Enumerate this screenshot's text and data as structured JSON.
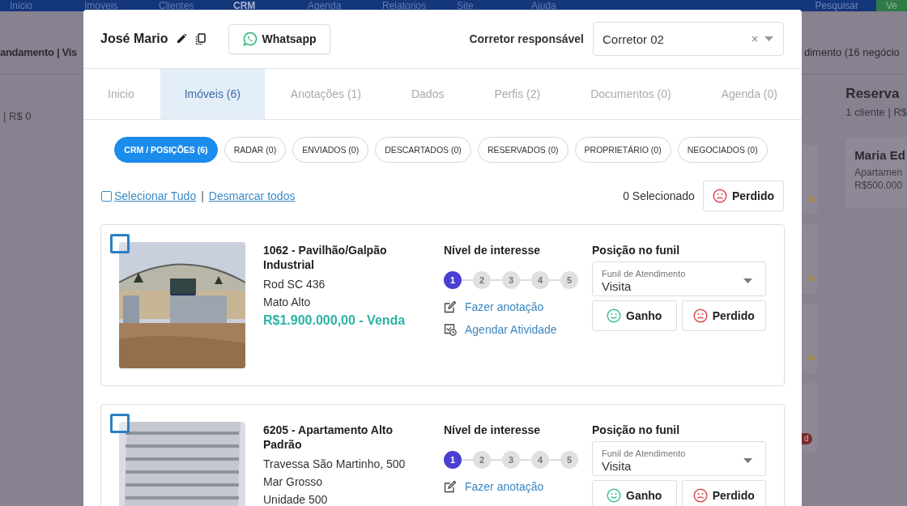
{
  "background_page": {
    "nav": [
      {
        "label": "Inicio",
        "selected": false
      },
      {
        "label": "Imoveis",
        "selected": false
      },
      {
        "label": "Clientes",
        "selected": false
      },
      {
        "label": "CRM",
        "selected": true
      },
      {
        "label": "Agenda",
        "selected": false
      },
      {
        "label": "Relatorios",
        "selected": false
      },
      {
        "label": "Site",
        "selected": false
      },
      {
        "label": "Ajuda",
        "selected": false
      }
    ],
    "search": "Pesquisar",
    "action_button": "Ve",
    "left_column": {
      "title": "andamento | Vis",
      "summary": "| R$ 0"
    },
    "right_column": {
      "title": "dimento (16 negócio",
      "stage": "Reserva",
      "summary": "1 cliente | R$",
      "card": {
        "name": "Maria Ed",
        "type": "Apartamen",
        "price": "R$500.000"
      },
      "badge": "d"
    }
  },
  "modal": {
    "contact_name": "José Mario",
    "whatsapp_button": "Whatsapp",
    "broker_label": "Corretor responsável",
    "broker_value": "Corretor 02",
    "tabs": [
      {
        "label": "Inicio",
        "selected": false
      },
      {
        "label": "Imóveis (6)",
        "selected": true
      },
      {
        "label": "Anotações (1)",
        "selected": false
      },
      {
        "label": "Dados",
        "selected": false
      },
      {
        "label": "Perfis (2)",
        "selected": false
      },
      {
        "label": "Documentos (0)",
        "selected": false
      },
      {
        "label": "Agenda (0)",
        "selected": false
      }
    ],
    "filters": [
      {
        "label": "CRM / POSIÇÕES (6)",
        "selected": true
      },
      {
        "label": "RADAR (0)",
        "selected": false
      },
      {
        "label": "ENVIADOS (0)",
        "selected": false
      },
      {
        "label": "DESCARTADOS (0)",
        "selected": false
      },
      {
        "label": "RESERVADOS (0)",
        "selected": false
      },
      {
        "label": "PROPRIETÁRIO (0)",
        "selected": false
      },
      {
        "label": "NEGOCIADOS (0)",
        "selected": false
      }
    ],
    "select_all": {
      "checked": false,
      "label": "Selecionar Tudo",
      "separator": "|",
      "unselect_label": "Desmarcar todos"
    },
    "selected_count": "0 Selecionado",
    "lost_button": "Perdido",
    "properties": [
      {
        "checked": false,
        "photo": {
          "kind": "warehouse"
        },
        "title": "1062 - Pavilhão/Galpão Industrial",
        "lines": [
          "Rod SC 436",
          "Mato Alto"
        ],
        "price": "R$1.900.000,00 - Venda",
        "interest_label": "Nível de interesse",
        "levels": [
          {
            "label": "1",
            "selected": true
          },
          {
            "label": "2",
            "selected": false
          },
          {
            "label": "3",
            "selected": false
          },
          {
            "label": "4",
            "selected": false
          },
          {
            "label": "5",
            "selected": false
          }
        ],
        "actions": [
          {
            "kind": "note",
            "label": "Fazer anotação"
          },
          {
            "kind": "schedule",
            "label": "Agendar Atividade"
          }
        ],
        "funnel_label": "Posição no funil",
        "funnel_field_label": "Funil de Atendimento",
        "funnel_value": "Visita",
        "won_button": "Ganho",
        "lost_button": "Perdido"
      },
      {
        "checked": false,
        "photo": {
          "kind": "building"
        },
        "title": "6205 - Apartamento Alto Padrão",
        "lines": [
          "Travessa São Martinho, 500",
          "Mar Grosso",
          "Unidade 500"
        ],
        "interest_label": "Nível de interesse",
        "levels": [
          {
            "label": "1",
            "selected": true
          },
          {
            "label": "2",
            "selected": false
          },
          {
            "label": "3",
            "selected": false
          },
          {
            "label": "4",
            "selected": false
          },
          {
            "label": "5",
            "selected": false
          }
        ],
        "actions": [
          {
            "kind": "note",
            "label": "Fazer anotação"
          }
        ],
        "funnel_label": "Posição no funil",
        "funnel_field_label": "Funil de Atendimento",
        "funnel_value": "Visita",
        "won_button": "Ganho",
        "lost_button": "Perdido"
      }
    ]
  }
}
